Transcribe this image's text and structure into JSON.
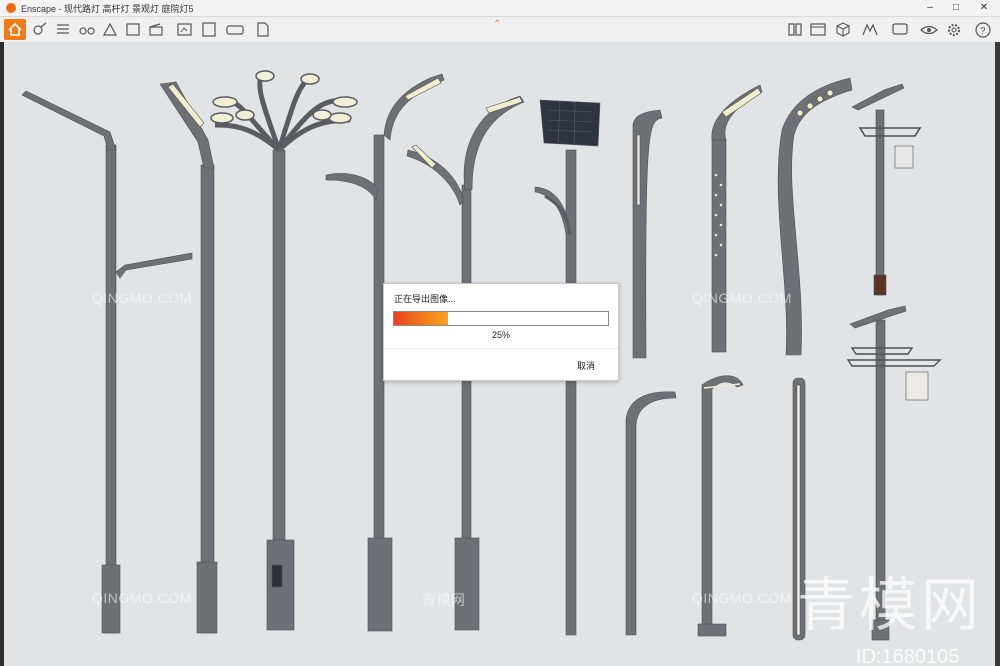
{
  "window": {
    "app_name": "Enscape",
    "title_separator": " - ",
    "document_title": "现代路灯 高杆灯 景观灯 庭院灯5",
    "minimize_icon": "minimize-icon",
    "maximize_icon": "maximize-icon",
    "close_icon": "close-icon"
  },
  "toolbar": {
    "accent_color": "#ef6a16",
    "left_icons": [
      "home-icon",
      "asset-library-icon",
      "bim-info-icon",
      "binoculars-icon",
      "floorplan-icon",
      "map-icon",
      "sun-icon",
      "clapper-icon",
      "screenshot-export-icon",
      "batch-export-icon",
      "panorama-export-icon",
      "export-file-icon"
    ],
    "collapse_icon": "chevron-up-icon",
    "right_icons": [
      "book-icon",
      "window-icon",
      "cube-icon",
      "upload-icon",
      "feedback-icon",
      "eye-icon",
      "gear-icon",
      "help-icon"
    ]
  },
  "dialog": {
    "title": "正在导出图像...",
    "progress_percent": 25,
    "progress_label": "25%",
    "cancel_label": "取消"
  },
  "watermarks": {
    "qingmo": "QINGMO.COM",
    "qingmo_cn": "青模网",
    "big_text": "青模网",
    "id_text": "ID:1680105"
  }
}
